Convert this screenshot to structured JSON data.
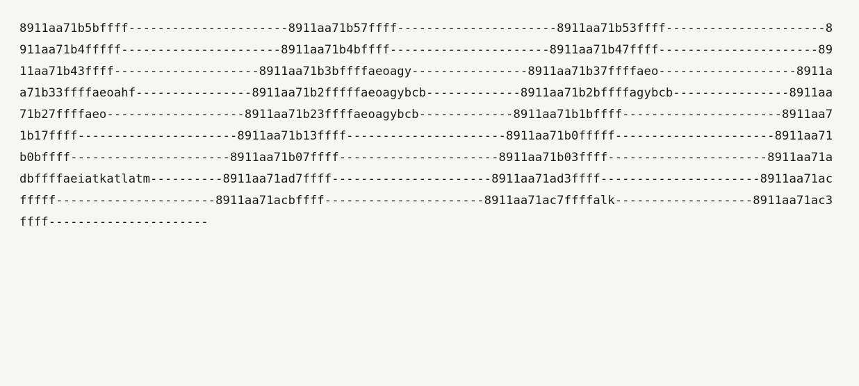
{
  "content": "8911aa71b5bffff----------------------8911aa71b57ffff----------------------8911aa71b53ffff----------------------8911aa71b4fffff----------------------8911aa71b4bffff----------------------8911aa71b47ffff----------------------8911aa71b43ffff--------------------8911aa71b3bffffaeoagy----------------8911aa71b37ffffaeo-------------------8911aa71b33ffffaeoahf----------------8911aa71b2fffffaeoagybcb-------------8911aa71b2bffffagybcb----------------8911aa71b27ffffaeo-------------------8911aa71b23ffffaeoagybcb-------------8911aa71b1bffff----------------------8911aa71b17ffff----------------------8911aa71b13ffff----------------------8911aa71b0fffff----------------------8911aa71b0bffff----------------------8911aa71b07ffff----------------------8911aa71b03ffff----------------------8911aa71adbffffaeiatkatlatm----------8911aa71ad7ffff----------------------8911aa71ad3ffff----------------------8911aa71acfffff----------------------8911aa71acbffff----------------------8911aa71ac7ffffalk-------------------8911aa71ac3ffff----------------------"
}
